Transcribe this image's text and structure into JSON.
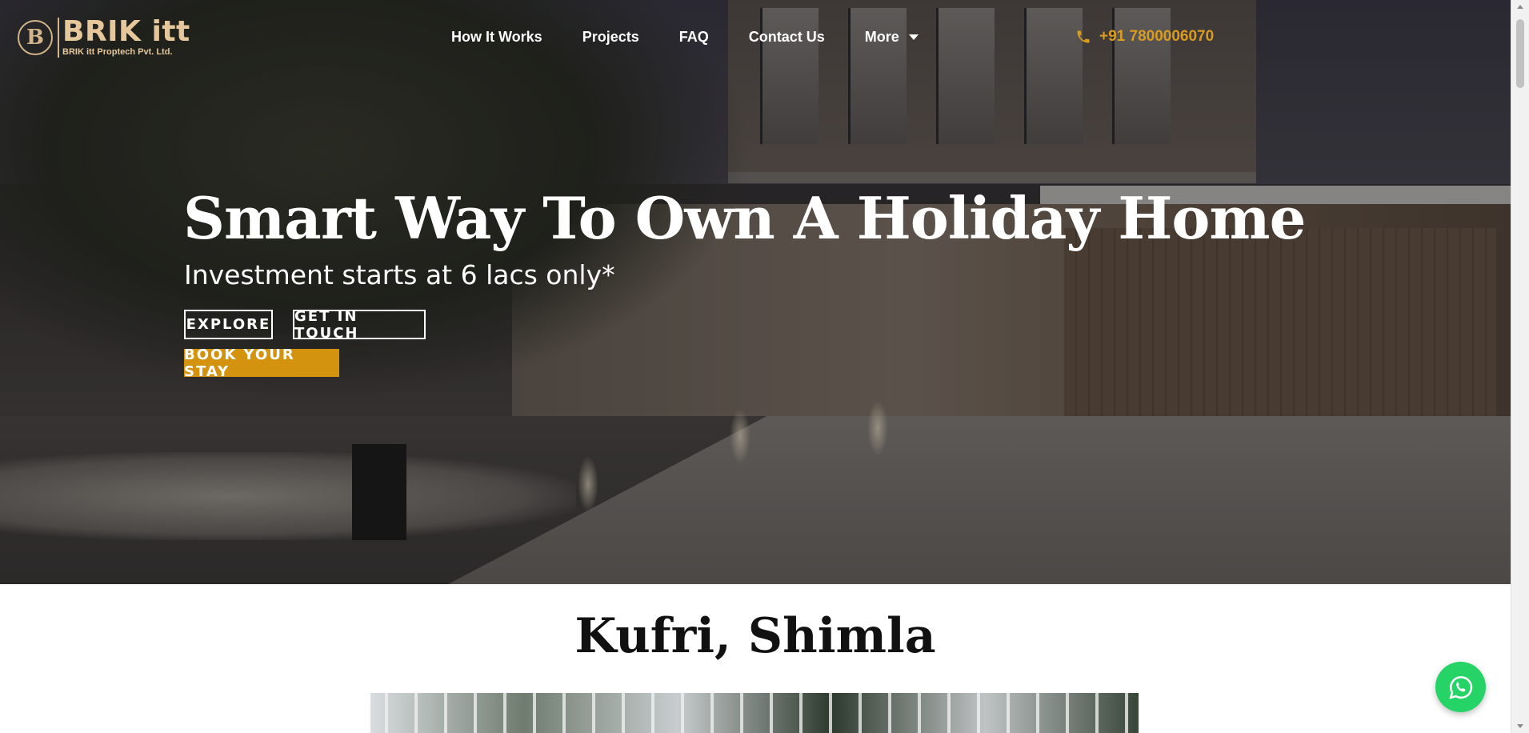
{
  "header": {
    "logo": {
      "mark": "B",
      "name": "BRIK itt",
      "subtitle": "BRIK itt Proptech Pvt. Ltd."
    },
    "nav": [
      {
        "label": "How It Works"
      },
      {
        "label": "Projects"
      },
      {
        "label": "FAQ"
      },
      {
        "label": "Contact Us"
      },
      {
        "label": "More"
      }
    ],
    "phone": "+91 7800006070"
  },
  "hero": {
    "title": "Smart Way To Own A Holiday Home",
    "subtitle": "Investment starts at 6 lacs only*",
    "buttons": {
      "explore": "EXPLORE",
      "get_in_touch": "GET IN TOUCH",
      "book_stay": "BOOK YOUR STAY"
    }
  },
  "section": {
    "title": "Kufri, Shimla"
  },
  "icons": {
    "phone": "phone-icon",
    "more_caret": "caret-down-icon",
    "whatsapp": "whatsapp-icon"
  },
  "colors": {
    "accent": "#d99b22",
    "book_button": "#d4930f",
    "logo_gold": "#e6c79c",
    "whatsapp": "#25d366"
  }
}
